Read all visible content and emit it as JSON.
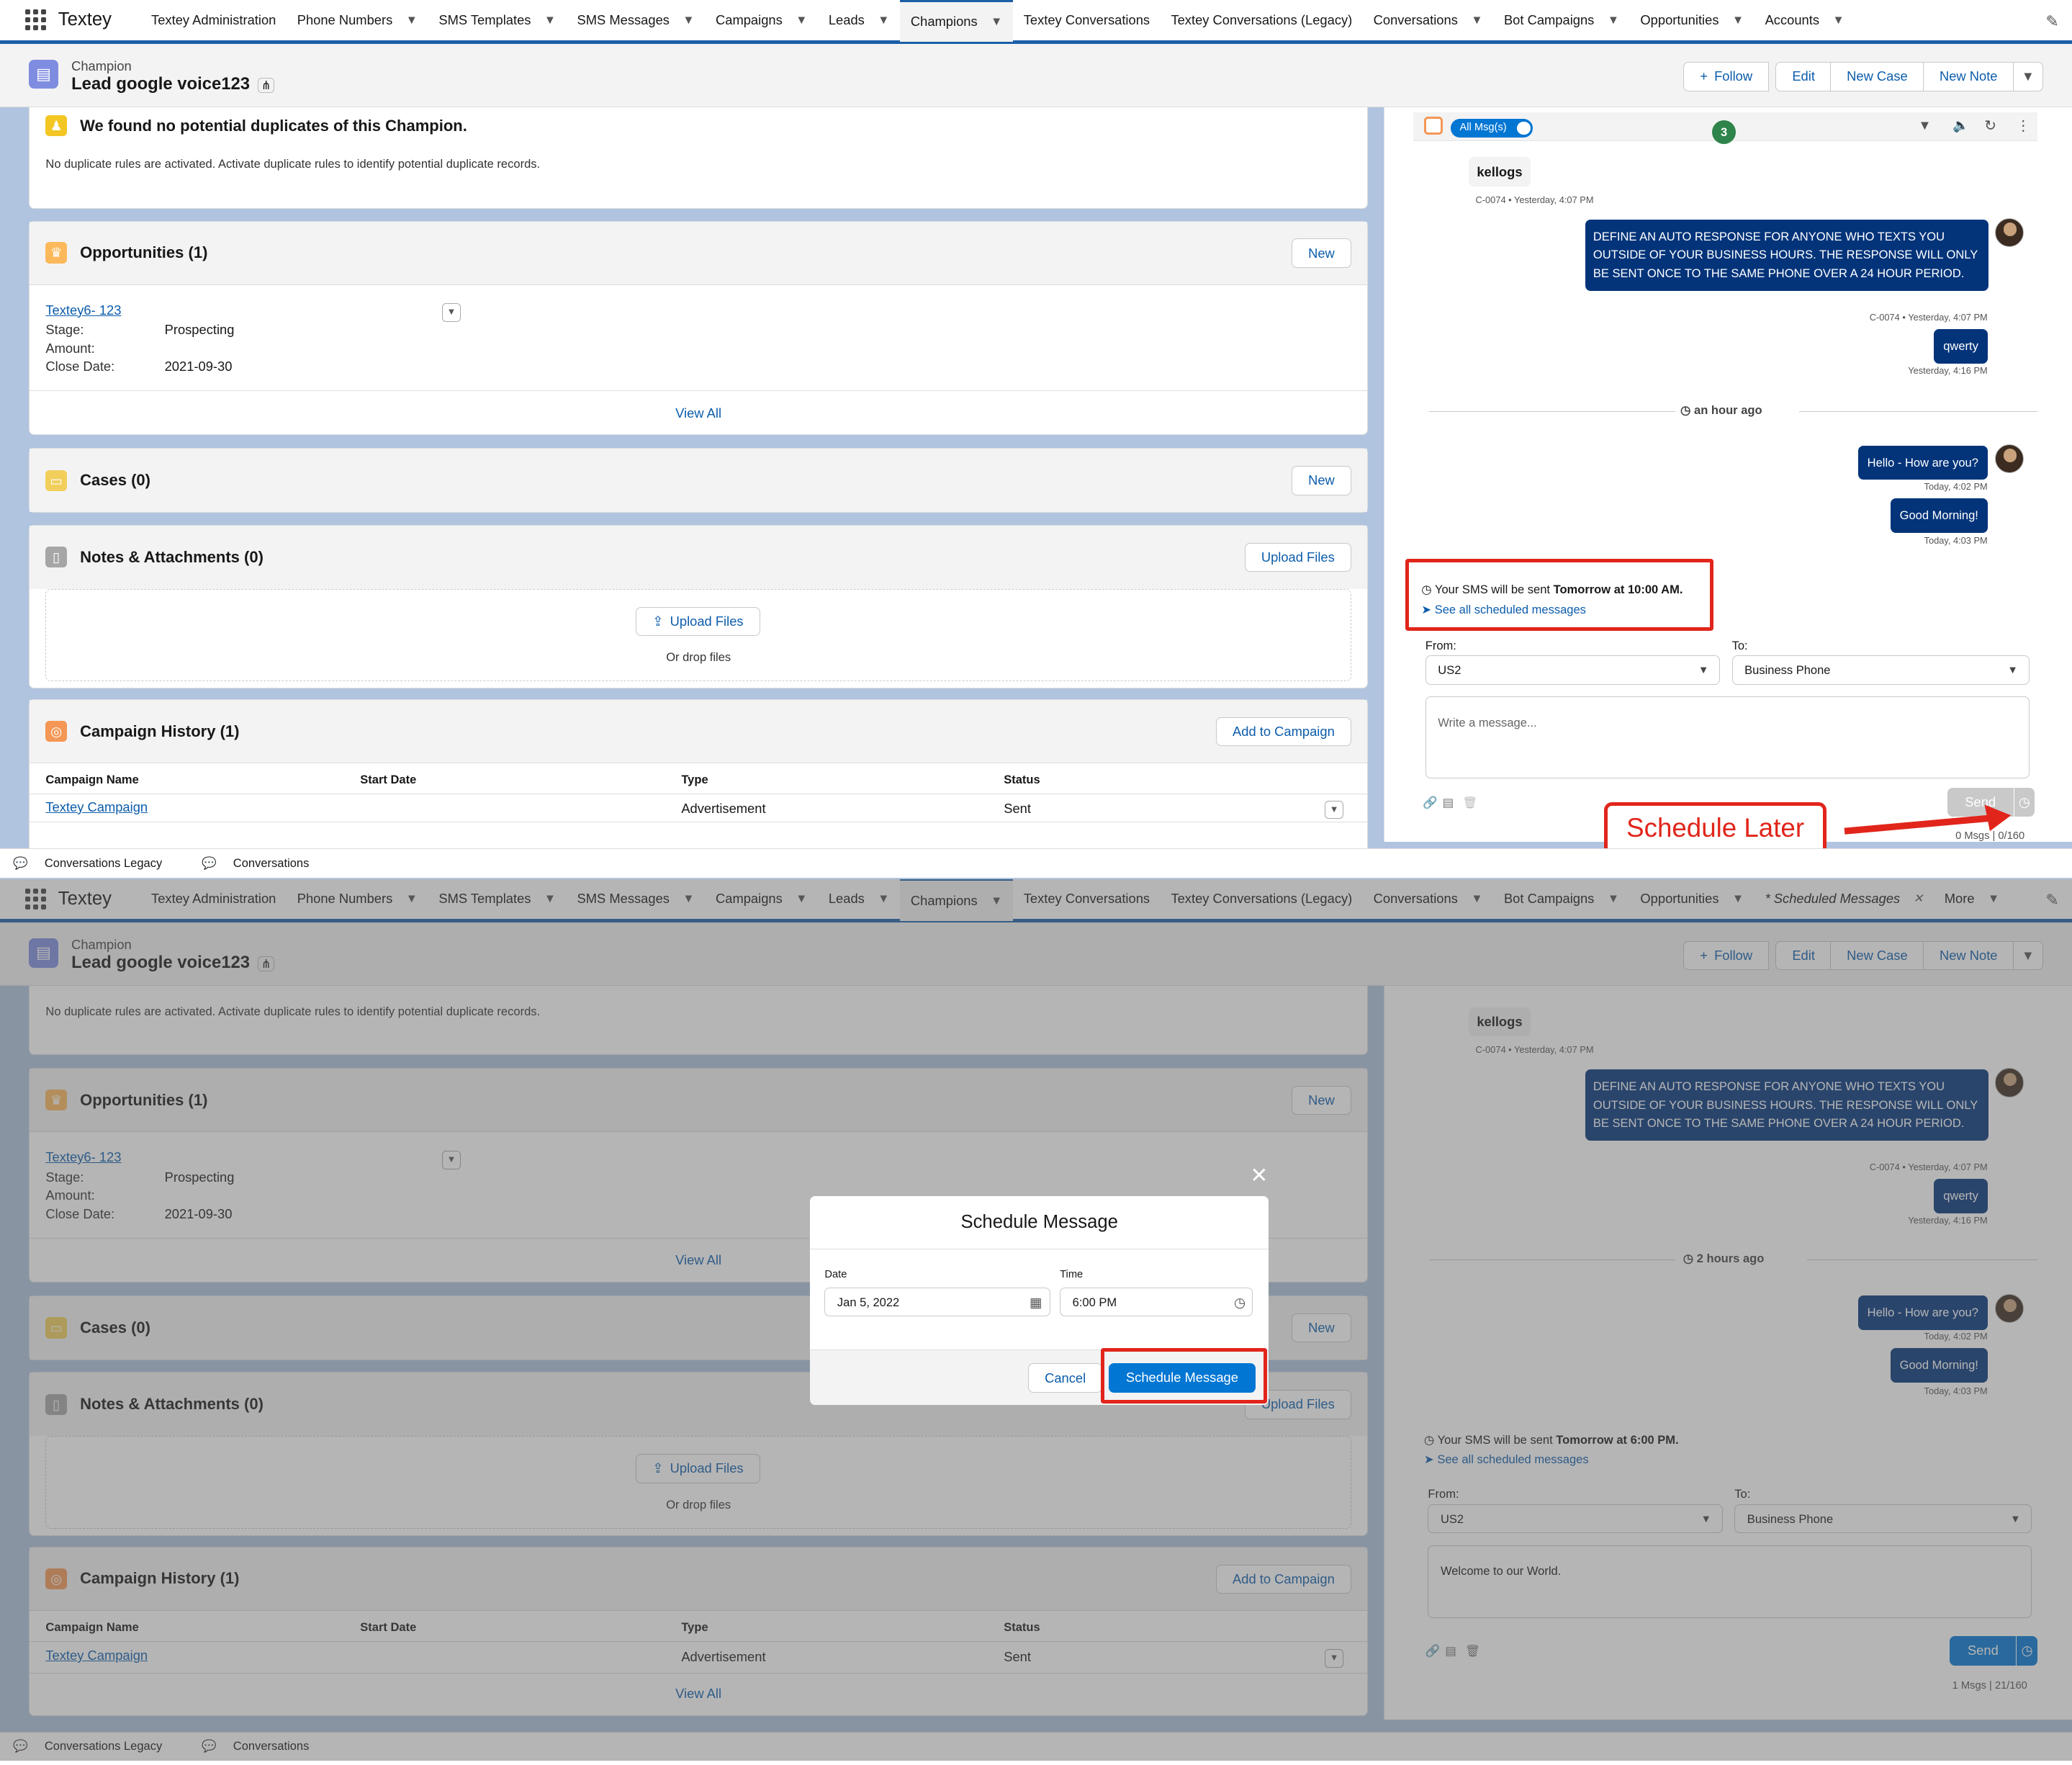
{
  "app": {
    "name": "Textey"
  },
  "nav": {
    "tabs": [
      "Textey Administration",
      "Phone Numbers",
      "SMS Templates",
      "SMS Messages",
      "Campaigns",
      "Leads",
      "Champions",
      "Textey Conversations",
      "Textey Conversations (Legacy)",
      "Conversations",
      "Bot Campaigns",
      "Opportunities",
      "Accounts"
    ],
    "tabs2": [
      "Textey Administration",
      "Phone Numbers",
      "SMS Templates",
      "SMS Messages",
      "Campaigns",
      "Leads",
      "Champions",
      "Textey Conversations",
      "Textey Conversations (Legacy)",
      "Conversations",
      "Bot Campaigns",
      "Opportunities"
    ],
    "scheduled_tab": "* Scheduled Messages",
    "more": "More"
  },
  "record": {
    "type": "Champion",
    "name": "Lead google voice123",
    "buttons": {
      "follow": "Follow",
      "edit": "Edit",
      "new_case": "New Case",
      "new_note": "New Note"
    }
  },
  "duplicates": {
    "title": "We found no potential duplicates of this Champion.",
    "note": "No duplicate rules are activated. Activate duplicate rules to identify potential duplicate records."
  },
  "opportunities": {
    "title": "Opportunities (1)",
    "new": "New",
    "item": {
      "name": "Textey6- 123",
      "stage_label": "Stage:",
      "stage": "Prospecting",
      "amount_label": "Amount:",
      "close_label": "Close Date:",
      "close": "2021-09-30"
    },
    "view_all": "View All"
  },
  "cases": {
    "title": "Cases (0)",
    "new": "New"
  },
  "notes": {
    "title": "Notes & Attachments (0)",
    "upload_btn": "Upload Files",
    "upload_inner": "Upload Files",
    "drop": "Or drop files"
  },
  "campaigns": {
    "title": "Campaign History (1)",
    "add": "Add to Campaign",
    "columns": [
      "Campaign Name",
      "Start Date",
      "Type",
      "Status"
    ],
    "row": {
      "name": "Textey Campaign",
      "start": "",
      "type": "Advertisement",
      "status": "Sent"
    },
    "view_all": "View All"
  },
  "chat": {
    "toggle": "All Msg(s)",
    "badge": "3",
    "contact": "kellogs",
    "contact_meta": "C-0074 • Yesterday, 4:07 PM",
    "msg1": "DEFINE AN AUTO RESPONSE FOR ANYONE WHO TEXTS YOU OUTSIDE OF YOUR BUSINESS HOURS. THE RESPONSE WILL ONLY BE SENT ONCE TO THE SAME PHONE OVER A 24 HOUR PERIOD.",
    "msg1_meta": "C-0074 • Yesterday, 4:07 PM",
    "msg2": "qwerty",
    "msg2_meta": "Yesterday, 4:16 PM",
    "divider1": "an hour ago",
    "divider2": "2 hours ago",
    "msg3": "Hello - How are you?",
    "msg3_meta": "Today, 4:02 PM",
    "msg4": "Good Morning!",
    "msg4_meta": "Today, 4:03 PM",
    "sched_prefix": "Your SMS will be sent ",
    "sched_when1": "Tomorrow at 10:00 AM.",
    "sched_when2": "Tomorrow at 6:00 PM.",
    "see_all": "See all scheduled messages",
    "from_label": "From:",
    "from_value": "US2",
    "to_label": "To:",
    "to_value": "Business Phone",
    "placeholder": "Write a message...",
    "message_value": "Welcome to our World.",
    "send": "Send",
    "counter1": "0 Msgs | 0/160",
    "counter2": "1 Msgs | 21/160"
  },
  "annotation": {
    "label": "Schedule Later"
  },
  "bottombar": {
    "item1": "Conversations Legacy",
    "item2": "Conversations"
  },
  "modal": {
    "title": "Schedule Message",
    "date_label": "Date",
    "date_value": "Jan 5, 2022",
    "time_label": "Time",
    "time_value": "6:00 PM",
    "cancel": "Cancel",
    "confirm": "Schedule Message"
  },
  "colors": {
    "brand": "#1b5fa8",
    "accent": "#0176d3",
    "bubble": "#03347a",
    "annotation": "#e1251b"
  }
}
